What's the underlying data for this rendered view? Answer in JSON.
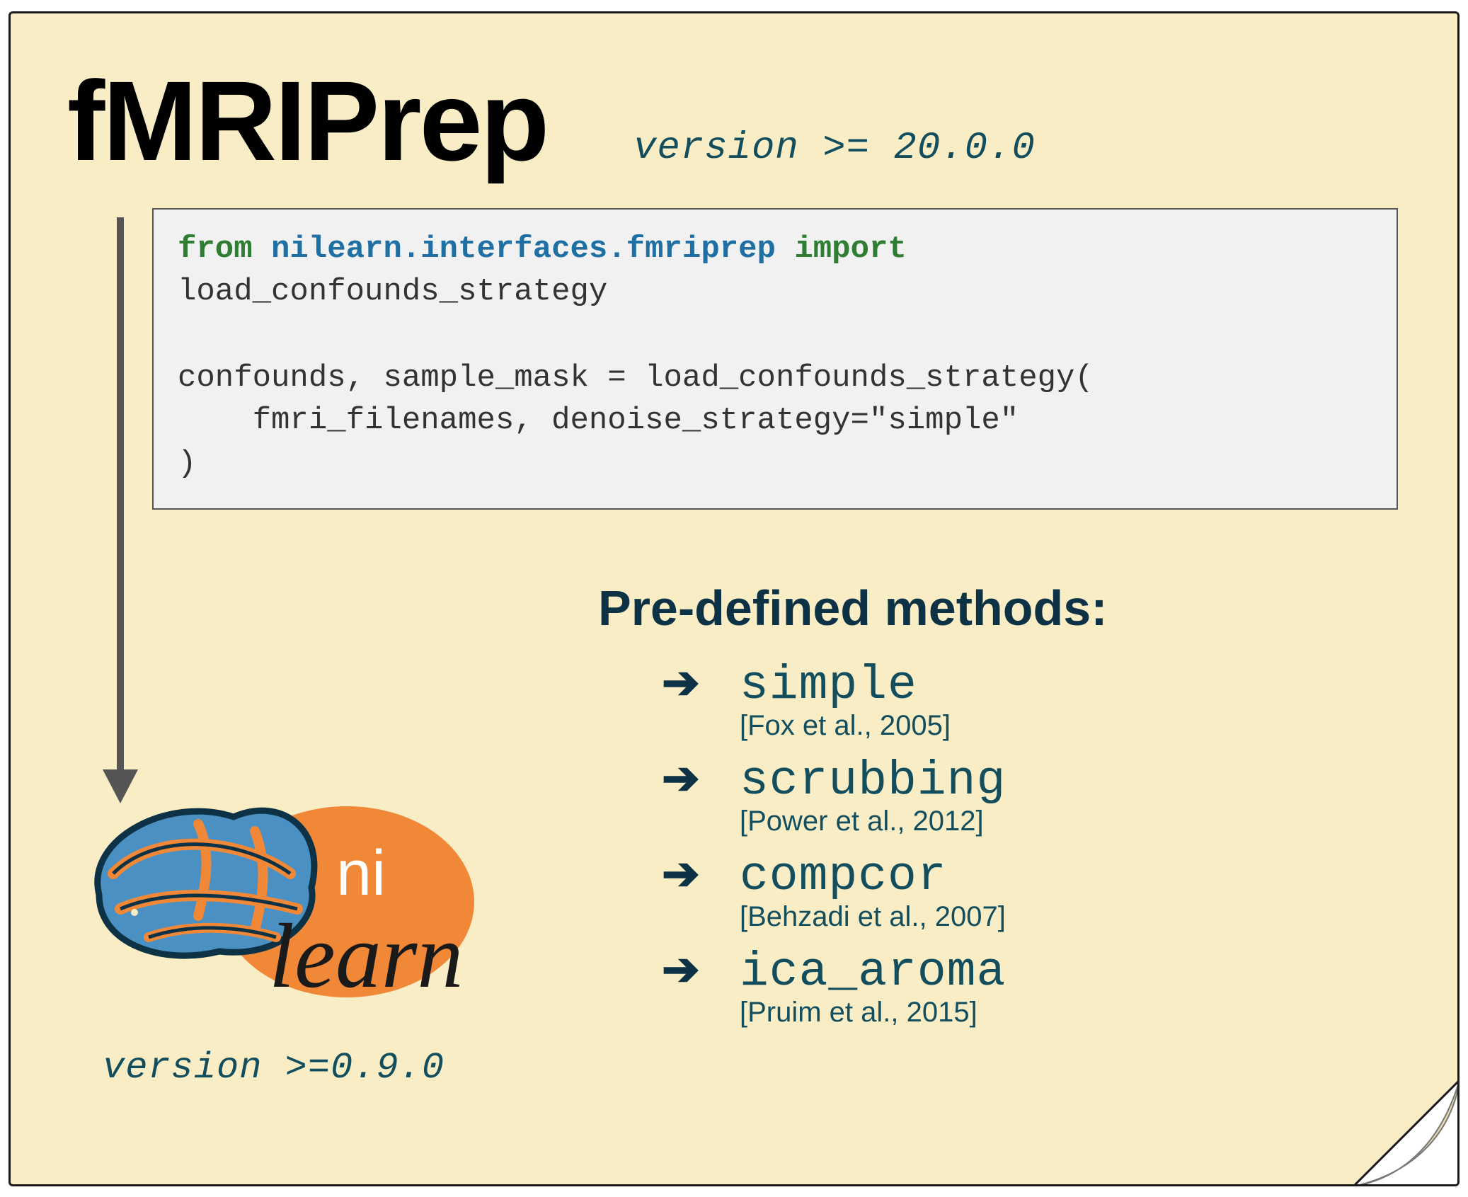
{
  "title": "fMRIPrep",
  "top_version": "version >= 20.0.0",
  "code": {
    "kw_from": "from",
    "module": "nilearn.interfaces.fmriprep",
    "kw_import": "import",
    "line1_rest": "load_confounds_strategy",
    "blank": "",
    "line3": "confounds, sample_mask = load_confounds_strategy(",
    "line4": "    fmri_filenames, denoise_strategy=\"simple\"",
    "line5": ")"
  },
  "bottom_version": "version >=0.9.0",
  "logo": {
    "ni": "ni",
    "learn": "learn"
  },
  "methods_title": "Pre-defined methods:",
  "methods": [
    {
      "name": "simple",
      "cite": "[Fox et al., 2005]"
    },
    {
      "name": "scrubbing",
      "cite": "[Power et al., 2012]"
    },
    {
      "name": "compcor",
      "cite": "[Behzadi et al., 2007]"
    },
    {
      "name": "ica_aroma",
      "cite": "[Pruim et al., 2015]"
    }
  ]
}
